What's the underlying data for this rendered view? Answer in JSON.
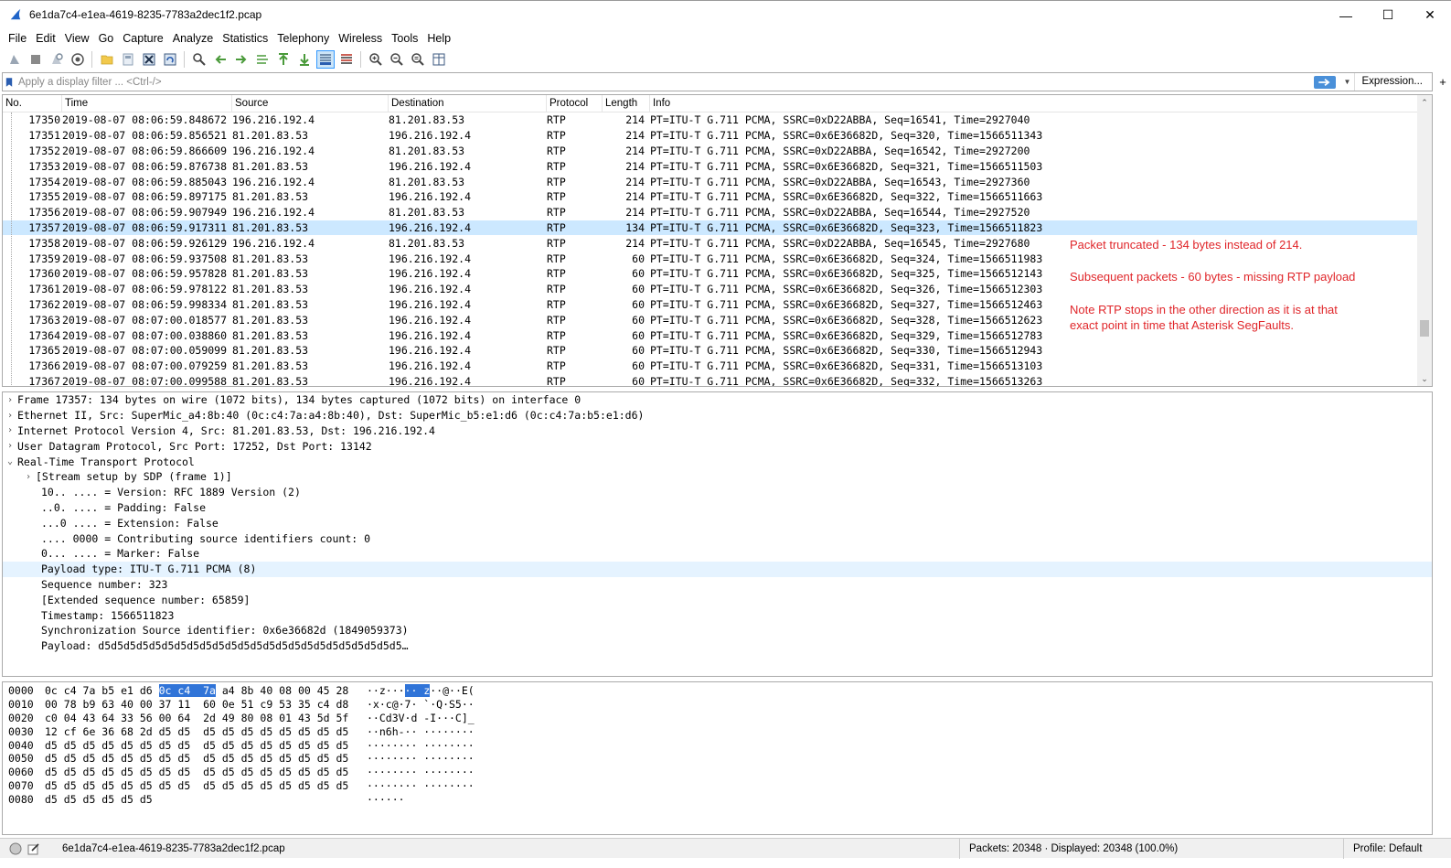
{
  "window": {
    "title": "6e1da7c4-e1ea-4619-8235-7783a2dec1f2.pcap",
    "minimize": "—",
    "maximize": "☐",
    "close": "✕"
  },
  "menu": [
    "File",
    "Edit",
    "View",
    "Go",
    "Capture",
    "Analyze",
    "Statistics",
    "Telephony",
    "Wireless",
    "Tools",
    "Help"
  ],
  "filter": {
    "placeholder": "Apply a display filter ... <Ctrl-/>",
    "expression_label": "Expression...",
    "plus_label": "+"
  },
  "packet_list": {
    "columns": [
      "No.",
      "Time",
      "Source",
      "Destination",
      "Protocol",
      "Length",
      "Info"
    ],
    "selected_no": "17357",
    "rows": [
      [
        "17350",
        "2019-08-07 08:06:59.848672",
        "196.216.192.4",
        "81.201.83.53",
        "RTP",
        "214",
        "PT=ITU-T G.711 PCMA, SSRC=0xD22ABBA, Seq=16541, Time=2927040"
      ],
      [
        "17351",
        "2019-08-07 08:06:59.856521",
        "81.201.83.53",
        "196.216.192.4",
        "RTP",
        "214",
        "PT=ITU-T G.711 PCMA, SSRC=0x6E36682D, Seq=320, Time=1566511343"
      ],
      [
        "17352",
        "2019-08-07 08:06:59.866609",
        "196.216.192.4",
        "81.201.83.53",
        "RTP",
        "214",
        "PT=ITU-T G.711 PCMA, SSRC=0xD22ABBA, Seq=16542, Time=2927200"
      ],
      [
        "17353",
        "2019-08-07 08:06:59.876738",
        "81.201.83.53",
        "196.216.192.4",
        "RTP",
        "214",
        "PT=ITU-T G.711 PCMA, SSRC=0x6E36682D, Seq=321, Time=1566511503"
      ],
      [
        "17354",
        "2019-08-07 08:06:59.885043",
        "196.216.192.4",
        "81.201.83.53",
        "RTP",
        "214",
        "PT=ITU-T G.711 PCMA, SSRC=0xD22ABBA, Seq=16543, Time=2927360"
      ],
      [
        "17355",
        "2019-08-07 08:06:59.897175",
        "81.201.83.53",
        "196.216.192.4",
        "RTP",
        "214",
        "PT=ITU-T G.711 PCMA, SSRC=0x6E36682D, Seq=322, Time=1566511663"
      ],
      [
        "17356",
        "2019-08-07 08:06:59.907949",
        "196.216.192.4",
        "81.201.83.53",
        "RTP",
        "214",
        "PT=ITU-T G.711 PCMA, SSRC=0xD22ABBA, Seq=16544, Time=2927520"
      ],
      [
        "17357",
        "2019-08-07 08:06:59.917311",
        "81.201.83.53",
        "196.216.192.4",
        "RTP",
        "134",
        "PT=ITU-T G.711 PCMA, SSRC=0x6E36682D, Seq=323, Time=1566511823"
      ],
      [
        "17358",
        "2019-08-07 08:06:59.926129",
        "196.216.192.4",
        "81.201.83.53",
        "RTP",
        "214",
        "PT=ITU-T G.711 PCMA, SSRC=0xD22ABBA, Seq=16545, Time=2927680"
      ],
      [
        "17359",
        "2019-08-07 08:06:59.937508",
        "81.201.83.53",
        "196.216.192.4",
        "RTP",
        "60",
        "PT=ITU-T G.711 PCMA, SSRC=0x6E36682D, Seq=324, Time=1566511983"
      ],
      [
        "17360",
        "2019-08-07 08:06:59.957828",
        "81.201.83.53",
        "196.216.192.4",
        "RTP",
        "60",
        "PT=ITU-T G.711 PCMA, SSRC=0x6E36682D, Seq=325, Time=1566512143"
      ],
      [
        "17361",
        "2019-08-07 08:06:59.978122",
        "81.201.83.53",
        "196.216.192.4",
        "RTP",
        "60",
        "PT=ITU-T G.711 PCMA, SSRC=0x6E36682D, Seq=326, Time=1566512303"
      ],
      [
        "17362",
        "2019-08-07 08:06:59.998334",
        "81.201.83.53",
        "196.216.192.4",
        "RTP",
        "60",
        "PT=ITU-T G.711 PCMA, SSRC=0x6E36682D, Seq=327, Time=1566512463"
      ],
      [
        "17363",
        "2019-08-07 08:07:00.018577",
        "81.201.83.53",
        "196.216.192.4",
        "RTP",
        "60",
        "PT=ITU-T G.711 PCMA, SSRC=0x6E36682D, Seq=328, Time=1566512623"
      ],
      [
        "17364",
        "2019-08-07 08:07:00.038860",
        "81.201.83.53",
        "196.216.192.4",
        "RTP",
        "60",
        "PT=ITU-T G.711 PCMA, SSRC=0x6E36682D, Seq=329, Time=1566512783"
      ],
      [
        "17365",
        "2019-08-07 08:07:00.059099",
        "81.201.83.53",
        "196.216.192.4",
        "RTP",
        "60",
        "PT=ITU-T G.711 PCMA, SSRC=0x6E36682D, Seq=330, Time=1566512943"
      ],
      [
        "17366",
        "2019-08-07 08:07:00.079259",
        "81.201.83.53",
        "196.216.192.4",
        "RTP",
        "60",
        "PT=ITU-T G.711 PCMA, SSRC=0x6E36682D, Seq=331, Time=1566513103"
      ],
      [
        "17367",
        "2019-08-07 08:07:00.099588",
        "81.201.83.53",
        "196.216.192.4",
        "RTP",
        "60",
        "PT=ITU-T G.711 PCMA, SSRC=0x6E36682D, Seq=332, Time=1566513263"
      ]
    ]
  },
  "annotations": {
    "note1": "Packet truncated - 134 bytes instead of 214.",
    "note2": "Subsequent packets - 60 bytes - missing RTP payload",
    "note3_line1": "Note RTP stops in the other direction as it is at that",
    "note3_line2": "exact point in time that Asterisk SegFaults."
  },
  "details": {
    "top": [
      {
        "expander": "›",
        "text": "Frame 17357: 134 bytes on wire (1072 bits), 134 bytes captured (1072 bits) on interface 0"
      },
      {
        "expander": "›",
        "text": "Ethernet II, Src: SuperMic_a4:8b:40 (0c:c4:7a:a4:8b:40), Dst: SuperMic_b5:e1:d6 (0c:c4:7a:b5:e1:d6)"
      },
      {
        "expander": "›",
        "text": "Internet Protocol Version 4, Src: 81.201.83.53, Dst: 196.216.192.4"
      },
      {
        "expander": "›",
        "text": "User Datagram Protocol, Src Port: 17252, Dst Port: 13142"
      },
      {
        "expander": "⌄",
        "text": "Real-Time Transport Protocol"
      }
    ],
    "rtp_stream_expander": "›",
    "rtp_stream": "[Stream setup by SDP (frame 1)]",
    "rtp_fields": [
      "10.. .... = Version: RFC 1889 Version (2)",
      "..0. .... = Padding: False",
      "...0 .... = Extension: False",
      ".... 0000 = Contributing source identifiers count: 0",
      "0... .... = Marker: False",
      "Payload type: ITU-T G.711 PCMA (8)",
      "Sequence number: 323",
      "[Extended sequence number: 65859]",
      "Timestamp: 1566511823",
      "Synchronization Source identifier: 0x6e36682d (1849059373)",
      "Payload: d5d5d5d5d5d5d5d5d5d5d5d5d5d5d5d5d5d5d5d5d5d5d5d5…"
    ],
    "highlighted_field": "Payload type: ITU-T G.711 PCMA (8)"
  },
  "hex": {
    "rows": [
      {
        "off": "0000",
        "pre": "0c c4 7a b5 e1 d6 ",
        "sel": "0c c4  7a",
        "post": " a4 8b 40 08 00 45 28",
        "apre": "··z···",
        "asel": "·· z",
        "apost": "··@··E("
      },
      {
        "off": "0010",
        "pre": "00 78 b9 63 40 00 37 11  60 0e 51 c9 53 35 c4 d8",
        "sel": "",
        "post": "",
        "apre": "·x·c@·7· `·Q·S5··",
        "asel": "",
        "apost": ""
      },
      {
        "off": "0020",
        "pre": "c0 04 43 64 33 56 00 64  2d 49 80 08 01 43 5d 5f",
        "sel": "",
        "post": "",
        "apre": "··Cd3V·d -I···C]_",
        "asel": "",
        "apost": ""
      },
      {
        "off": "0030",
        "pre": "12 cf 6e 36 68 2d d5 d5  d5 d5 d5 d5 d5 d5 d5 d5",
        "sel": "",
        "post": "",
        "apre": "··n6h-·· ········",
        "asel": "",
        "apost": ""
      },
      {
        "off": "0040",
        "pre": "d5 d5 d5 d5 d5 d5 d5 d5  d5 d5 d5 d5 d5 d5 d5 d5",
        "sel": "",
        "post": "",
        "apre": "········ ········",
        "asel": "",
        "apost": ""
      },
      {
        "off": "0050",
        "pre": "d5 d5 d5 d5 d5 d5 d5 d5  d5 d5 d5 d5 d5 d5 d5 d5",
        "sel": "",
        "post": "",
        "apre": "········ ········",
        "asel": "",
        "apost": ""
      },
      {
        "off": "0060",
        "pre": "d5 d5 d5 d5 d5 d5 d5 d5  d5 d5 d5 d5 d5 d5 d5 d5",
        "sel": "",
        "post": "",
        "apre": "········ ········",
        "asel": "",
        "apost": ""
      },
      {
        "off": "0070",
        "pre": "d5 d5 d5 d5 d5 d5 d5 d5  d5 d5 d5 d5 d5 d5 d5 d5",
        "sel": "",
        "post": "",
        "apre": "········ ········",
        "asel": "",
        "apost": ""
      },
      {
        "off": "0080",
        "pre": "d5 d5 d5 d5 d5 d5",
        "sel": "",
        "post": "",
        "apre": "······",
        "asel": "",
        "apost": ""
      }
    ]
  },
  "status": {
    "file": "6e1da7c4-e1ea-4619-8235-7783a2dec1f2.pcap",
    "packets": "Packets: 20348 · Displayed: 20348 (100.0%)",
    "profile": "Profile: Default"
  },
  "colors": {
    "selected_row": "#cce8ff",
    "highlight_field": "#e5f3ff",
    "hex_selection": "#3074d8",
    "annotation_red": "#e0262a",
    "wireshark_fin": "#1f64c8"
  }
}
